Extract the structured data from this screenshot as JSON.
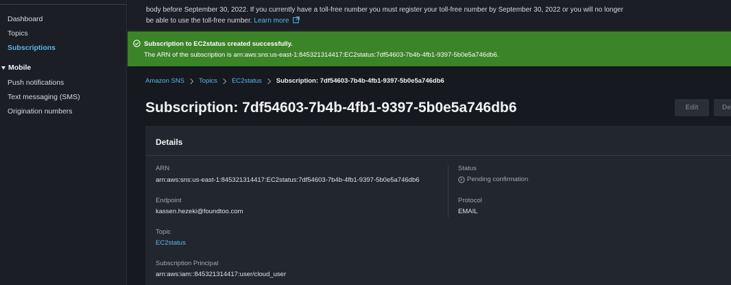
{
  "sidebar": {
    "items": [
      {
        "label": "Dashboard"
      },
      {
        "label": "Topics"
      },
      {
        "label": "Subscriptions",
        "active": true
      }
    ],
    "group": {
      "label": "Mobile"
    },
    "group_items": [
      {
        "label": "Push notifications"
      },
      {
        "label": "Text messaging (SMS)"
      },
      {
        "label": "Origination numbers"
      }
    ]
  },
  "info_banner": {
    "line1": "body before September 30, 2022. If you currently have a toll-free number you must register your toll-free number by September 30, 2022 or you will no longer",
    "line2": "be able to use the toll-free number.",
    "learn_more": "Learn more"
  },
  "success_banner": {
    "title": "Subscription to EC2status created successfully.",
    "text": "The ARN of the subscription is arn:aws:sns:us-east-1:845321314417:EC2status:7df54603-7b4b-4fb1-9397-5b0e5a746db6."
  },
  "breadcrumb": {
    "items": [
      "Amazon SNS",
      "Topics",
      "EC2status"
    ],
    "current": "Subscription: 7df54603-7b4b-4fb1-9397-5b0e5a746db6"
  },
  "page": {
    "title": "Subscription: 7df54603-7b4b-4fb1-9397-5b0e5a746db6",
    "edit_label": "Edit",
    "delete_label": "De"
  },
  "details": {
    "title": "Details",
    "arn_label": "ARN",
    "arn_value": "arn:aws:sns:us-east-1:845321314417:EC2status:7df54603-7b4b-4fb1-9397-5b0e5a746db6",
    "endpoint_label": "Endpoint",
    "endpoint_value": "kassen.hezeki@foundtoo.com",
    "topic_label": "Topic",
    "topic_value": "EC2status",
    "principal_label": "Subscription Principal",
    "principal_value": "arn:aws:iam::845321314417:user/cloud_user",
    "status_label": "Status",
    "status_value": "Pending confirmation",
    "protocol_label": "Protocol",
    "protocol_value": "EMAIL"
  },
  "colors": {
    "accent_link": "#5fb6ea",
    "success": "#3b8427",
    "background": "#16191f",
    "panel": "#22262e"
  },
  "icons": [
    "external-link-icon",
    "check-circle-icon",
    "chevron-right-icon",
    "clock-icon",
    "caret-down-icon"
  ]
}
